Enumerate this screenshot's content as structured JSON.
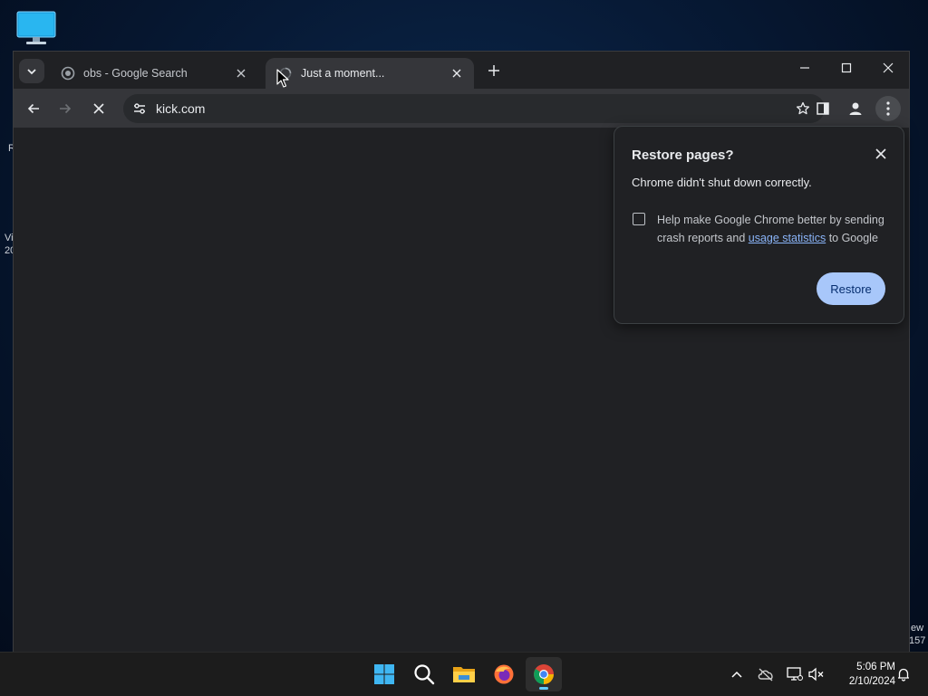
{
  "desktop": {
    "fragments": [
      "R",
      "Vi",
      "20",
      "ew",
      "157"
    ]
  },
  "tabs": [
    {
      "title": "obs - Google Search",
      "favicon": "google-icon",
      "active": false
    },
    {
      "title": "Just a moment...",
      "favicon": "loading-icon",
      "active": true
    }
  ],
  "toolbar": {
    "url": "kick.com"
  },
  "restore_dialog": {
    "title": "Restore pages?",
    "message": "Chrome didn't shut down correctly.",
    "checkbox_text_before": "Help make Google Chrome better by sending crash reports and ",
    "checkbox_link": "usage statistics",
    "checkbox_text_after": " to Google",
    "checkbox_checked": false,
    "restore_label": "Restore"
  },
  "taskbar": {
    "apps": [
      "start-icon",
      "search-icon",
      "file-explorer-icon",
      "firefox-icon",
      "chrome-icon"
    ],
    "time": "5:06 PM",
    "date": "2/10/2024"
  },
  "colors": {
    "accent": "#a8c7fa",
    "link": "#8ab4f8",
    "window_bg": "#202124",
    "toolbar_bg": "#35363a"
  }
}
